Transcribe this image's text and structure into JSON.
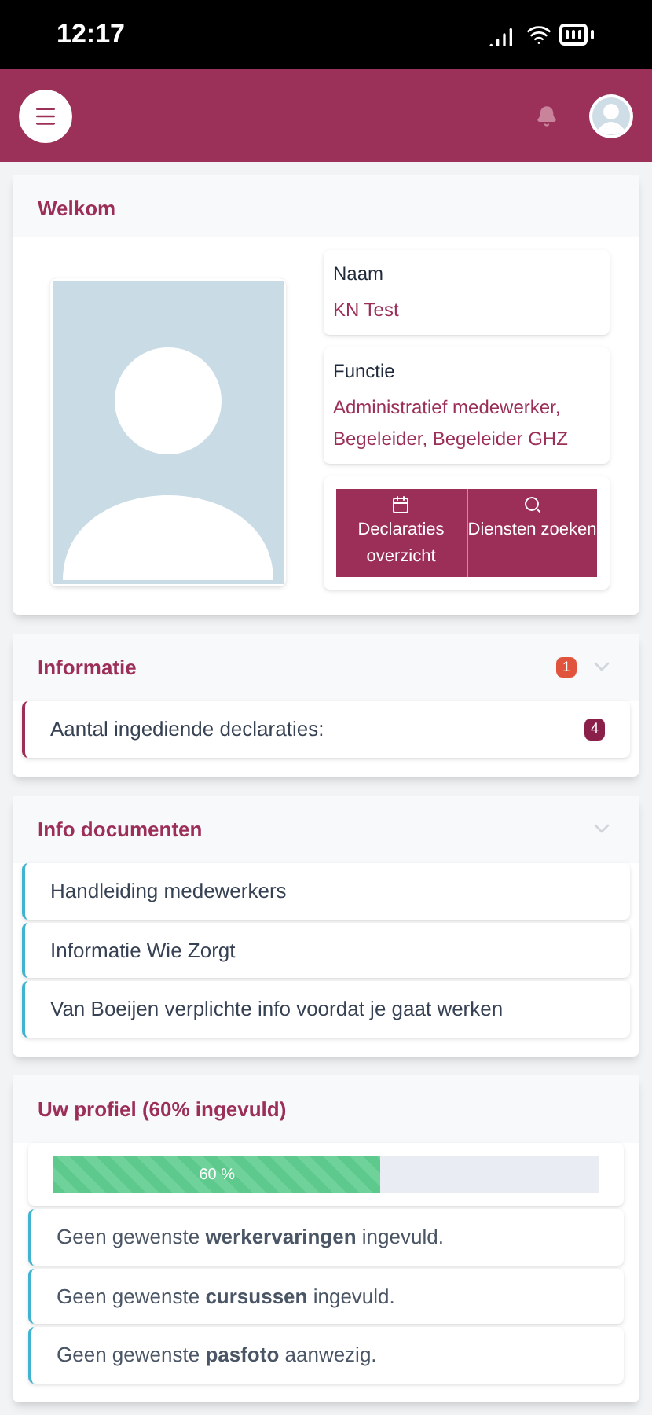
{
  "status_bar": {
    "time": "12:17"
  },
  "welcome": {
    "title": "Welkom",
    "fields": [
      {
        "label": "Naam",
        "value": "KN Test"
      },
      {
        "label": "Functie",
        "value": "Administratief medewerker, Begeleider, Begeleider GHZ"
      }
    ],
    "buttons": [
      {
        "kind": "calendar",
        "label": "Declaraties overzicht"
      },
      {
        "kind": "search",
        "label": "Diensten zoeken"
      }
    ]
  },
  "information": {
    "title": "Informatie",
    "badge": "1",
    "expanded": true,
    "items": [
      {
        "label": "Aantal ingediende declaraties:",
        "count": "4"
      }
    ]
  },
  "documents": {
    "title": "Info documenten",
    "expanded": true,
    "items": [
      "Handleiding medewerkers",
      "Informatie Wie Zorgt",
      "Van Boeijen verplichte info voordat je gaat werken"
    ]
  },
  "profile": {
    "title": "Uw profiel (60% ingevuld)",
    "progress": {
      "level": 0.6,
      "label": "60 %"
    },
    "items": [
      "Geen gewenste **werkervaringen** ingevuld.",
      "Geen gewenste **cursussen** ingevuld.",
      "Geen gewenste **pasfoto** aanwezig."
    ]
  }
}
